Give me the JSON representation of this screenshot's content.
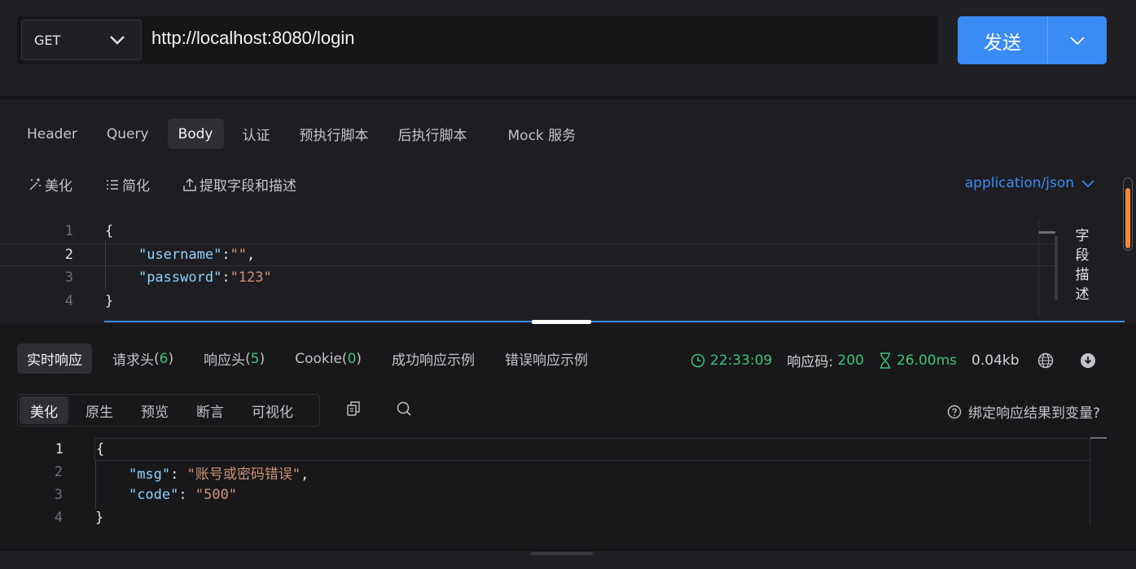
{
  "request": {
    "method": "GET",
    "url": "http://localhost:8080/login",
    "send_label": "发送"
  },
  "req_tabs": [
    "Header",
    "Query",
    "Body",
    "认证",
    "预执行脚本",
    "后执行脚本",
    "Mock 服务"
  ],
  "req_active_tab": "Body",
  "body_tools": {
    "beautify": "美化",
    "simplify": "简化",
    "extract": "提取字段和描述",
    "content_type": "application/json"
  },
  "body_lines": [
    "1",
    "2",
    "3",
    "4"
  ],
  "body_json": {
    "open": "{",
    "username_key": "\"username\"",
    "username_val": "\"\"",
    "password_key": "\"password\"",
    "password_val": "\"123\"",
    "close": "}"
  },
  "field_desc": [
    "字",
    "段",
    "描",
    "述"
  ],
  "response": {
    "tabs": {
      "realtime": "实时响应",
      "req_headers": "请求头",
      "req_headers_count": "6",
      "res_headers": "响应头",
      "res_headers_count": "5",
      "cookie": "Cookie",
      "cookie_count": "0",
      "success_example": "成功响应示例",
      "error_example": "错误响应示例"
    },
    "time": "22:33:09",
    "status_label": "响应码:",
    "status_code": "200",
    "duration": "26.00ms",
    "size": "0.04kb",
    "view_tabs": [
      "美化",
      "原生",
      "预览",
      "断言",
      "可视化"
    ],
    "view_active": "美化",
    "bind_label": "绑定响应结果到变量?",
    "lines": [
      "1",
      "2",
      "3",
      "4"
    ],
    "json": {
      "open": "{",
      "msg_key": "\"msg\"",
      "msg_val": "\"账号或密码错误\"",
      "code_key": "\"code\"",
      "code_val": "\"500\"",
      "close": "}"
    }
  },
  "colors": {
    "accent": "#3b8bf5",
    "success": "#3ec47a",
    "string": "#ce9178",
    "key": "#8fd2fb"
  }
}
